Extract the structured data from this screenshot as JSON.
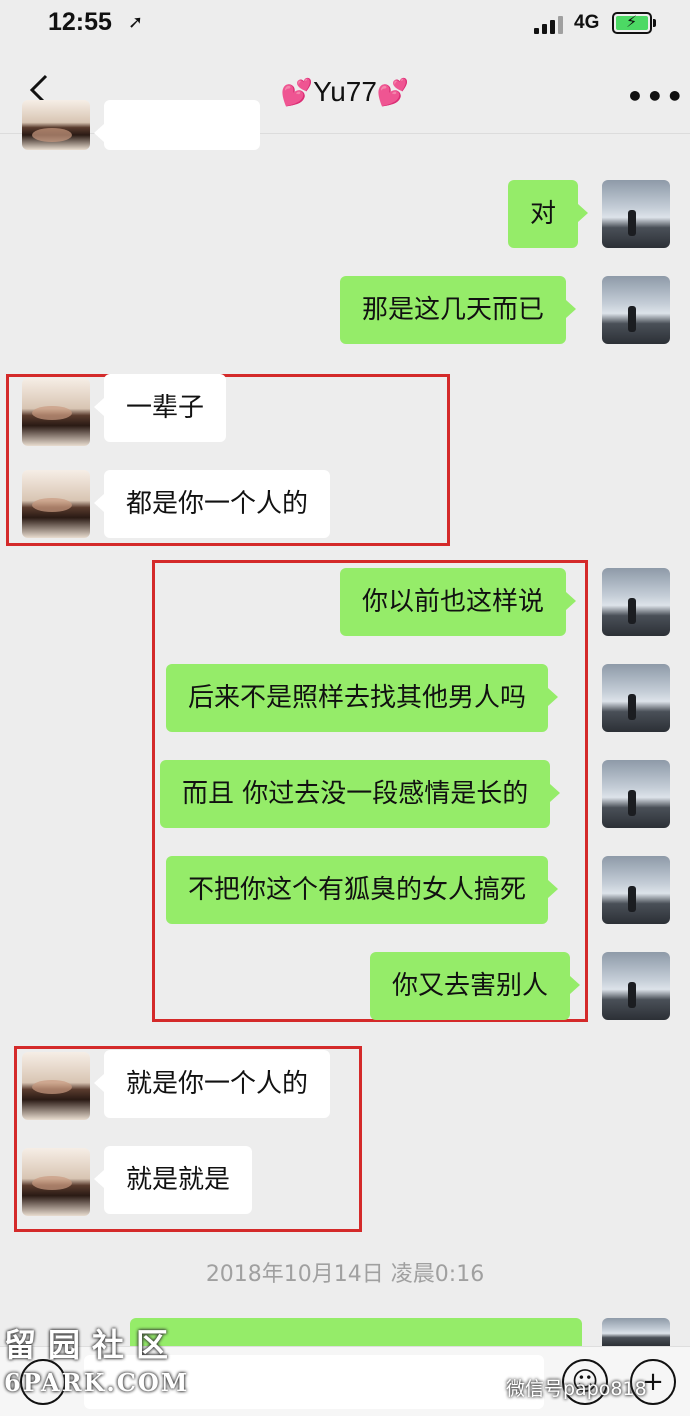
{
  "status_bar": {
    "time": "12:55",
    "network": "4G"
  },
  "nav": {
    "title": "Yu77",
    "more": "•••"
  },
  "messages": [
    {
      "side": "in",
      "text": ""
    },
    {
      "side": "out",
      "text": "对"
    },
    {
      "side": "out",
      "text": "那是这几天而已"
    },
    {
      "side": "in",
      "text": "一辈子"
    },
    {
      "side": "in",
      "text": "都是你一个人的"
    },
    {
      "side": "out",
      "text": "你以前也这样说"
    },
    {
      "side": "out",
      "text": "后来不是照样去找其他男人吗"
    },
    {
      "side": "out",
      "text": "而且 你过去没一段感情是长的"
    },
    {
      "side": "out",
      "text": "不把你这个有狐臭的女人搞死"
    },
    {
      "side": "out",
      "text": "你又去害别人"
    },
    {
      "side": "in",
      "text": "就是你一个人的"
    },
    {
      "side": "in",
      "text": "就是就是"
    }
  ],
  "timestamp": "2018年10月14日 凌晨0:16",
  "watermarks": {
    "left_line1": "留园社区",
    "left_line2": "6PARK.COM",
    "right": "微信号papo818"
  }
}
